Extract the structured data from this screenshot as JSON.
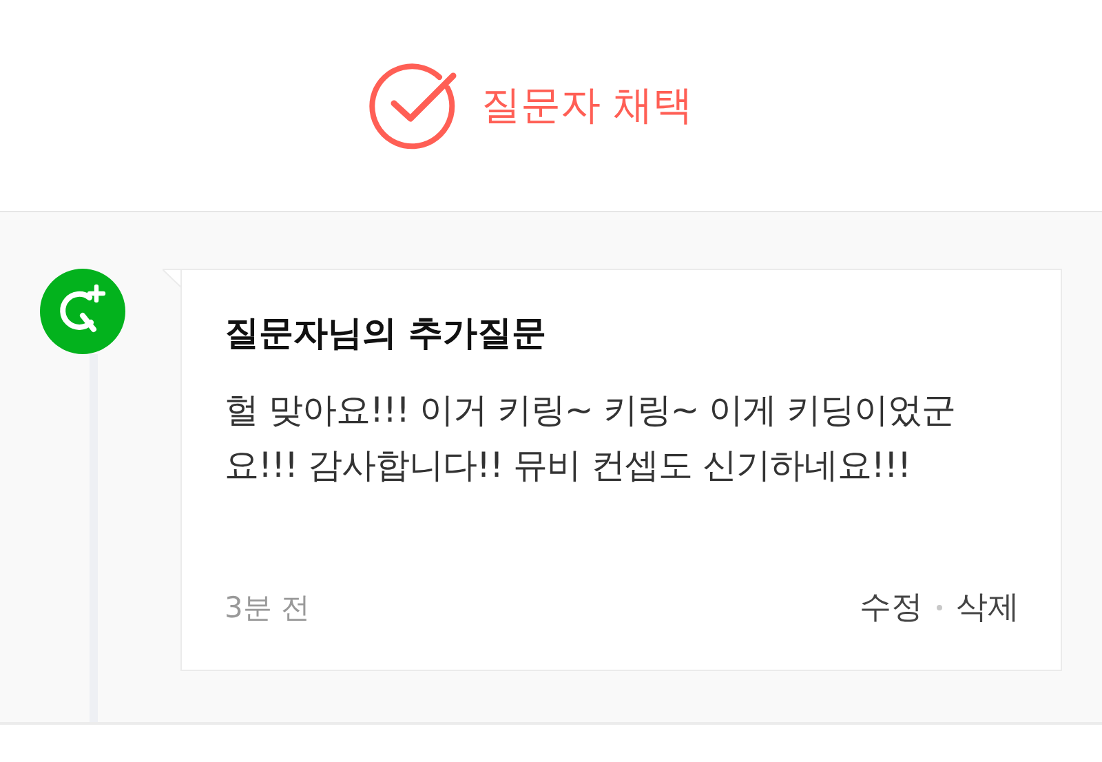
{
  "adopt_banner": {
    "label": "질문자 채택"
  },
  "comment": {
    "title": "질문자님의 추가질문",
    "body": "헐 맞아요!!! 이거 키링~ 키링~ 이게 키딩이었군요!!! 감사합니다!! 뮤비 컨셉도 신기하네요!!!",
    "time": "3분 전",
    "actions": [
      "수정",
      "삭제"
    ]
  }
}
